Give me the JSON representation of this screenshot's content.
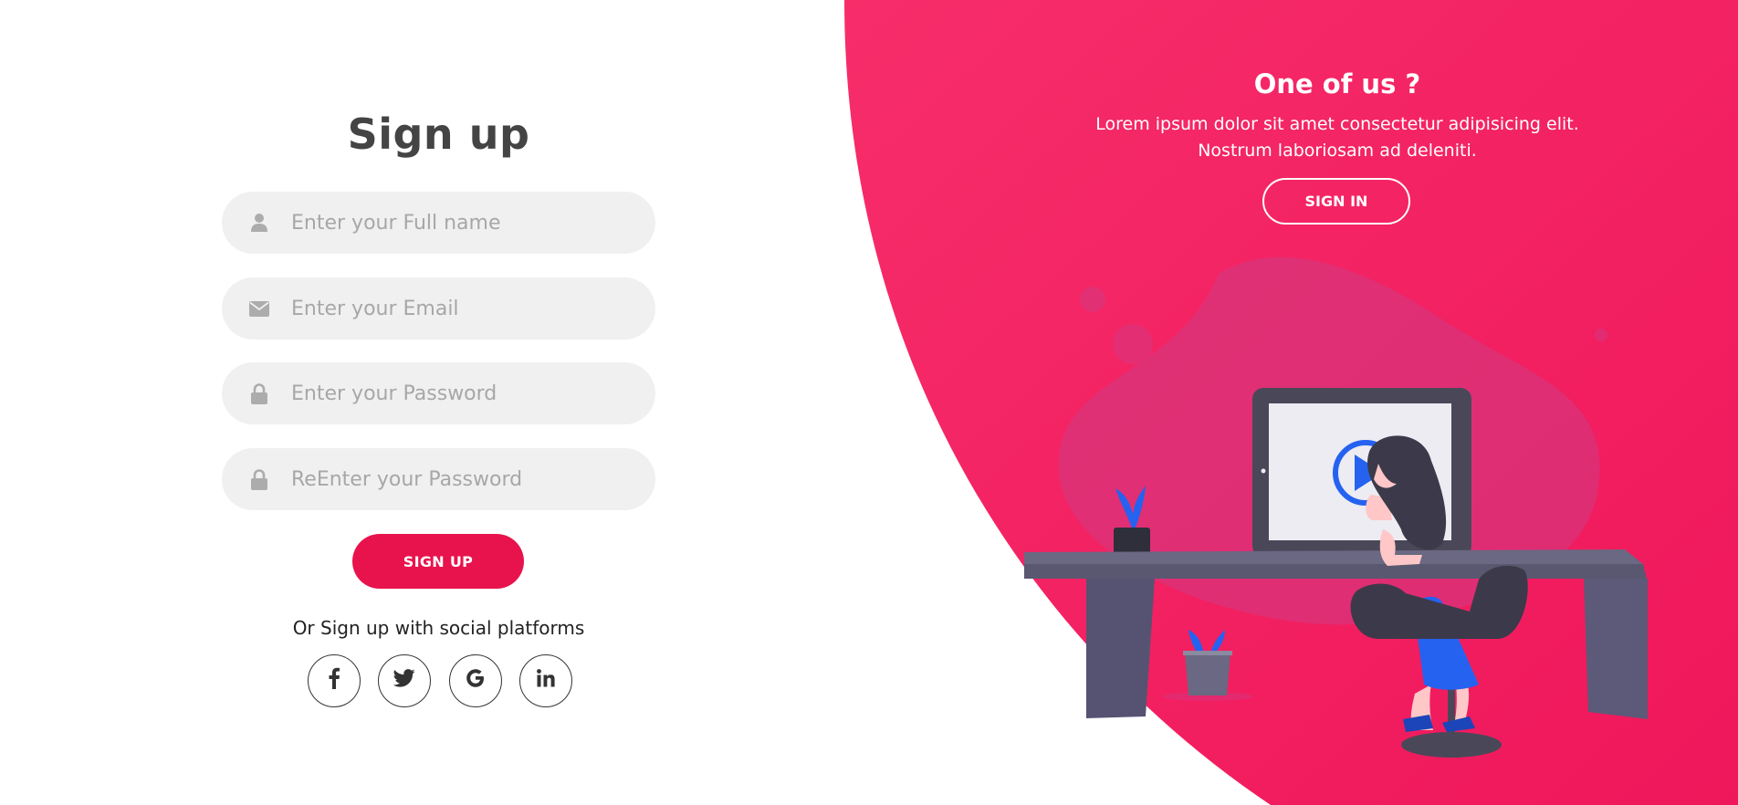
{
  "signup": {
    "title": "Sign up",
    "fields": [
      {
        "placeholder": "Enter your Full name",
        "icon": "user-icon"
      },
      {
        "placeholder": "Enter your Email",
        "icon": "envelope-icon"
      },
      {
        "placeholder": "Enter your Password",
        "icon": "lock-icon"
      },
      {
        "placeholder": "ReEnter your Password",
        "icon": "lock-icon"
      }
    ],
    "button_label": "SIGN UP",
    "social_text": "Or Sign up with social platforms",
    "socials": [
      {
        "icon": "facebook-icon",
        "glyph": "f"
      },
      {
        "icon": "twitter-icon",
        "glyph": "t"
      },
      {
        "icon": "google-icon",
        "glyph": "G"
      },
      {
        "icon": "linkedin-icon",
        "glyph": "in"
      }
    ]
  },
  "panel": {
    "title": "One of us ?",
    "text": "Lorem ipsum dolor sit amet consectetur adipisicing elit. Nostrum laboriosam ad deleniti.",
    "button_label": "SIGN IN"
  },
  "colors": {
    "accent": "#e8134d",
    "pink_start": "#f72d6a",
    "pink_end": "#f0175c",
    "input_bg": "#f0f0f0",
    "title_text": "#444444"
  }
}
